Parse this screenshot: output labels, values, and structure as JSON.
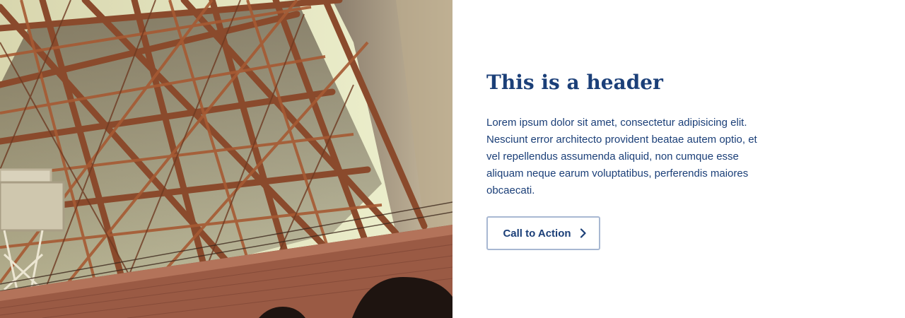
{
  "hero": {
    "image_alt": "Steel lattice framework of a bridge tower above a brick archway",
    "heading": "This is a header",
    "body": "Lorem ipsum dolor sit amet, consectetur adipisicing elit. Nesciunt error architecto provident beatae autem optio, et vel repellendus assumenda aliquid, non cumque esse aliquam neque earum voluptatibus, perferendis maiores obcaecati.",
    "cta": {
      "label": "Call to Action",
      "icon": "chevron-right-icon"
    }
  },
  "colors": {
    "primary_text": "#1b3f78",
    "button_border": "#a8b8d2",
    "background": "#ffffff"
  }
}
